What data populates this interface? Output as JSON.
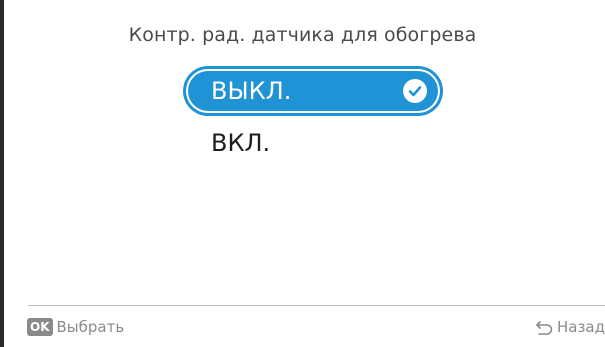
{
  "title": "Контр. рад. датчика для обогрева",
  "options": [
    {
      "label": "ВЫКЛ.",
      "selected": true
    },
    {
      "label": "ВКЛ.",
      "selected": false
    }
  ],
  "footer": {
    "ok_badge": "OK",
    "select_label": "Выбрать",
    "back_label": "Назад"
  },
  "icons": {
    "selected_marker": "check-circle-icon",
    "back": "return-arrow-icon"
  },
  "colors": {
    "accent": "#1f93d6",
    "footer_text": "#8a8a8a",
    "divider": "#bdbdbd"
  }
}
